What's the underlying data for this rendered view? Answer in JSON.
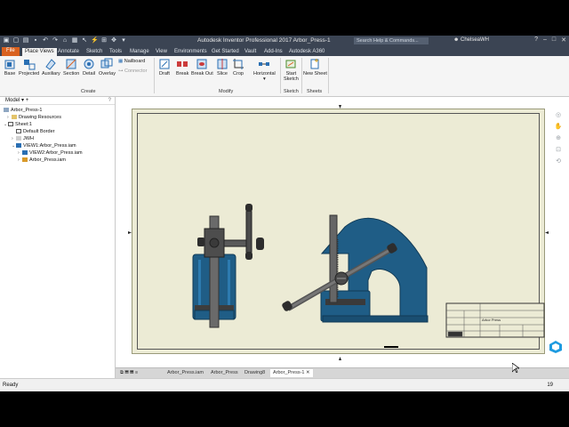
{
  "title_bar": {
    "app_title": "Autodesk Inventor Professional 2017   Arbor_Press-1",
    "search_placeholder": "Search Help & Commands...",
    "user_name": "ChelseaWH"
  },
  "menu_tabs": [
    "File",
    "Place Views",
    "Annotate",
    "Sketch",
    "Tools",
    "Manage",
    "View",
    "Environments",
    "Get Started",
    "Vault",
    "Add-Ins",
    "Autodesk A360"
  ],
  "active_tab": "Place Views",
  "ribbon": {
    "create": {
      "label": "Create",
      "buttons": [
        "Base",
        "Projected",
        "Auxiliary",
        "Section",
        "Detail",
        "Overlay"
      ],
      "small": [
        "Nailboard",
        "Connector"
      ]
    },
    "modify": {
      "label": "Modify",
      "buttons": [
        "Draft",
        "Break",
        "Break Out",
        "Slice",
        "Crop",
        "Horizontal"
      ]
    },
    "sketch": {
      "label": "Sketch",
      "button_line1": "Start",
      "button_line2": "Sketch"
    },
    "sheets": {
      "label": "Sheets",
      "button": "New Sheet"
    }
  },
  "browser": {
    "header": "Model",
    "help": "?",
    "items": [
      "Arbor_Press-1",
      "Drawing Resources",
      "Sheet:1",
      "Default Border",
      "JWH",
      "VIEW1:Arbor_Press.iam",
      "VIEW2:Arbor_Press.iam",
      "Arbor_Press.iam"
    ]
  },
  "doc_tabs": [
    "Arbor_Press.iam",
    "Arbor_Press",
    "Drawing8",
    "Arbor_Press-1"
  ],
  "active_doc": "Arbor_Press-1",
  "status": {
    "text": "Ready",
    "count": "19"
  },
  "title_block": {
    "part_name": "Arbor Press"
  },
  "colors": {
    "accent": "#d9611f",
    "titlebar": "#3b4453",
    "sheet": "#ecebd5",
    "part_blue": "#1f5d86"
  }
}
